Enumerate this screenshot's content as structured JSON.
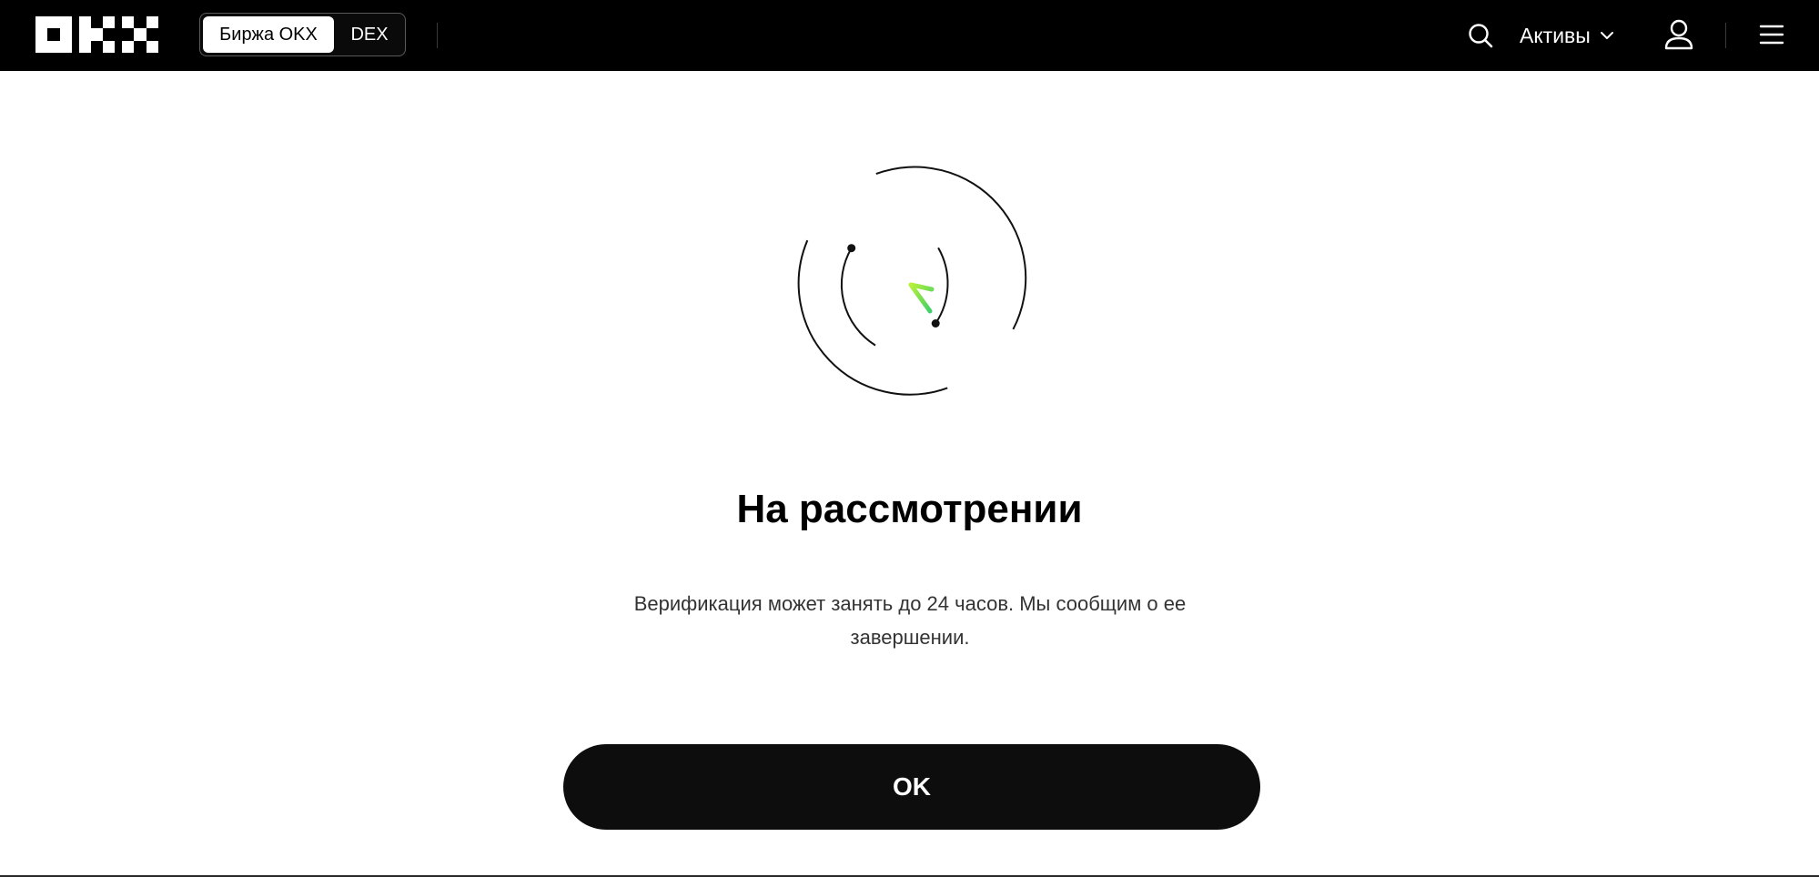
{
  "header": {
    "tabs": [
      {
        "label": "Биржа OKX",
        "active": true
      },
      {
        "label": "DEX",
        "active": false
      }
    ],
    "assets_label": "Активы",
    "icons": [
      "okx-logo",
      "search-icon",
      "chevron-down-icon",
      "user-icon",
      "menu-icon"
    ]
  },
  "main": {
    "title": "На рассмотрении",
    "description": "Верификация может занять до 24 часов. Мы сообщим о ее завершении.",
    "ok_label": "OK",
    "illustration": "pending-clock-illustration"
  },
  "colors": {
    "header_bg": "#000000",
    "page_bg": "#ffffff",
    "button_bg": "#0d0d0d",
    "accent_green_start": "#b8f03a",
    "accent_green_end": "#3ccf6a"
  }
}
